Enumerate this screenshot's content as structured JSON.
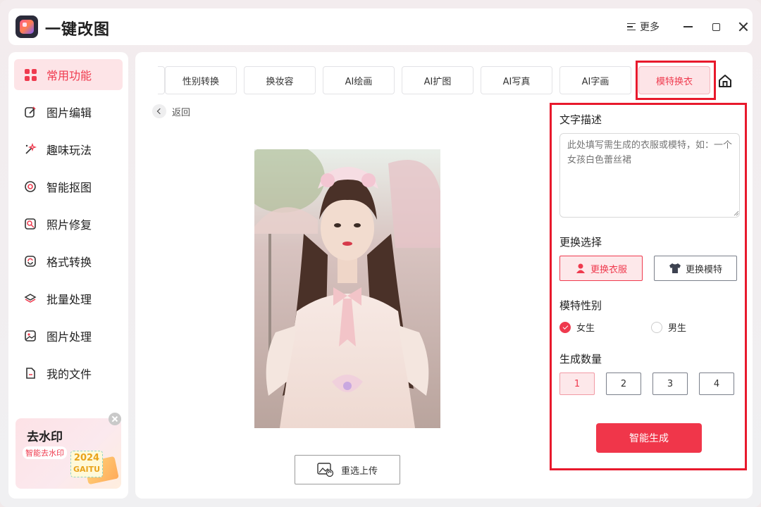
{
  "app": {
    "title": "一键改图"
  },
  "titlebar": {
    "more_label": "更多"
  },
  "sidebar": {
    "items": [
      {
        "label": "常用功能",
        "icon": "grid-icon",
        "active": true
      },
      {
        "label": "图片编辑",
        "icon": "edit-icon"
      },
      {
        "label": "趣味玩法",
        "icon": "magic-wand-icon"
      },
      {
        "label": "智能抠图",
        "icon": "target-icon"
      },
      {
        "label": "照片修复",
        "icon": "photo-repair-icon"
      },
      {
        "label": "格式转换",
        "icon": "convert-icon"
      },
      {
        "label": "批量处理",
        "icon": "layers-icon"
      },
      {
        "label": "图片处理",
        "icon": "image-icon"
      },
      {
        "label": "我的文件",
        "icon": "file-icon"
      }
    ],
    "promo": {
      "title": "去水印",
      "subtitle": "智能去水印",
      "year": "2024",
      "brand": "GAITU"
    }
  },
  "main": {
    "tabs": [
      {
        "label": "性别转换"
      },
      {
        "label": "换妆容"
      },
      {
        "label": "AI绘画"
      },
      {
        "label": "AI扩图"
      },
      {
        "label": "AI写真"
      },
      {
        "label": "AI字画"
      },
      {
        "label": "模特换衣",
        "active": true
      }
    ],
    "back_label": "返回",
    "reupload_label": "重选上传"
  },
  "settings": {
    "description_title": "文字描述",
    "description_placeholder": "此处填写需生成的衣服或模特，如：一个女孩白色蕾丝裙",
    "replace_title": "更换选择",
    "replace_options": [
      {
        "label": "更换衣服",
        "icon": "person-icon",
        "active": true
      },
      {
        "label": "更换模特",
        "icon": "shirt-icon"
      }
    ],
    "gender_title": "模特性别",
    "gender_options": [
      {
        "label": "女生",
        "checked": true
      },
      {
        "label": "男生",
        "checked": false
      }
    ],
    "count_title": "生成数量",
    "count_options": [
      "1",
      "2",
      "3",
      "4"
    ],
    "count_selected": "1",
    "generate_label": "智能生成"
  },
  "colors": {
    "accent": "#ef3a4e",
    "accent_bg": "#fde4e7",
    "highlight": "#e8192c"
  }
}
